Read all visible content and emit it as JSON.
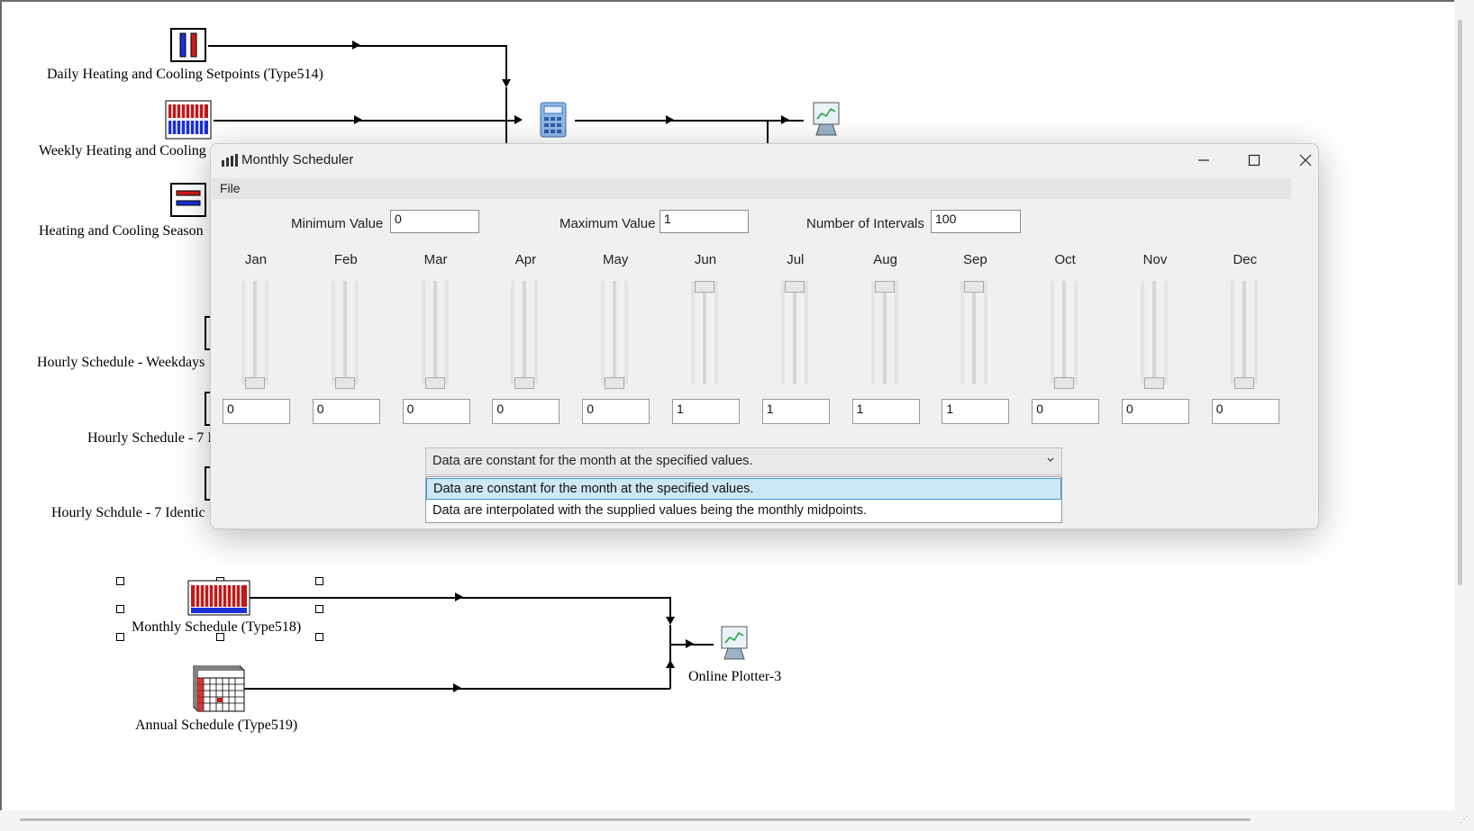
{
  "canvas": {
    "components": [
      {
        "name": "Daily Heating and Cooling Setpoints (Type514)"
      },
      {
        "name": "Weekly Heating and Cooling"
      },
      {
        "name": "Heating and Cooling Season"
      },
      {
        "name": "Hourly Schedule - Weekdays"
      },
      {
        "name": "Hourly Schedule - 7 I"
      },
      {
        "name": "Hourly Schdule - 7 Identic"
      },
      {
        "name": "Monthly Schedule (Type518)"
      },
      {
        "name": "Annual Schedule (Type519)"
      },
      {
        "name": "Online Plotter-3"
      }
    ]
  },
  "dialog": {
    "title": "Monthly Scheduler",
    "menu_file": "File",
    "min_label": "Minimum Value",
    "min_value": "0",
    "max_label": "Maximum Value",
    "max_value": "1",
    "intervals_label": "Number of Intervals",
    "intervals_value": "100",
    "months": [
      {
        "name": "Jan",
        "value": "0",
        "level": 0
      },
      {
        "name": "Feb",
        "value": "0",
        "level": 0
      },
      {
        "name": "Mar",
        "value": "0",
        "level": 0
      },
      {
        "name": "Apr",
        "value": "0",
        "level": 0
      },
      {
        "name": "May",
        "value": "0",
        "level": 0
      },
      {
        "name": "Jun",
        "value": "1",
        "level": 1
      },
      {
        "name": "Jul",
        "value": "1",
        "level": 1
      },
      {
        "name": "Aug",
        "value": "1",
        "level": 1
      },
      {
        "name": "Sep",
        "value": "1",
        "level": 1
      },
      {
        "name": "Oct",
        "value": "0",
        "level": 0
      },
      {
        "name": "Nov",
        "value": "0",
        "level": 0
      },
      {
        "name": "Dec",
        "value": "0",
        "level": 0
      }
    ],
    "mode_selected": "Data are constant for the month at the specified values.",
    "mode_options": [
      "Data are constant for the month at the specified values.",
      "Data are interpolated with the supplied values being the monthly midpoints."
    ]
  },
  "icons": {
    "title": "chart-bars-icon",
    "minimize": "minimize-icon",
    "maximize": "maximize-icon",
    "close": "close-icon",
    "dropdown": "chevron-down-icon"
  }
}
